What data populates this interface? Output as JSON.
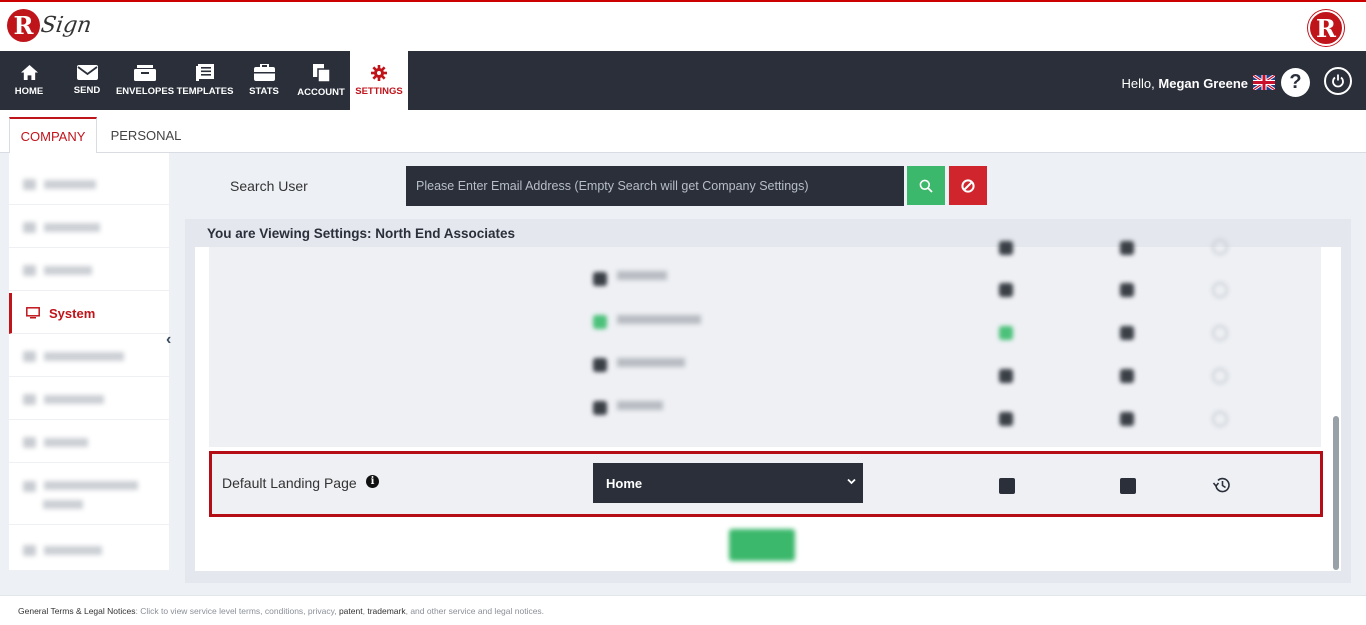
{
  "header": {
    "logo_letter": "R",
    "logo_text": "Sign",
    "right_logo_letter": "R"
  },
  "nav": {
    "items": [
      {
        "label": "HOME",
        "icon": "home-icon"
      },
      {
        "label": "SEND",
        "icon": "envelope-icon"
      },
      {
        "label": "ENVELOPES",
        "icon": "inbox-icon"
      },
      {
        "label": "TEMPLATES",
        "icon": "templates-icon"
      },
      {
        "label": "STATS",
        "icon": "briefcase-icon"
      },
      {
        "label": "ACCOUNT",
        "icon": "copy-icon"
      },
      {
        "label": "SETTINGS",
        "icon": "gear-icon",
        "active": true
      }
    ],
    "hello": "Hello,",
    "user_name": "Megan Greene",
    "help": "?"
  },
  "tabs": [
    {
      "label": "COMPANY",
      "active": true
    },
    {
      "label": "PERSONAL",
      "active": false
    }
  ],
  "sidebar": {
    "active_item": "System"
  },
  "search": {
    "label": "Search User",
    "placeholder": "Please Enter Email Address (Empty Search will get Company Settings)"
  },
  "panel": {
    "title": "You are Viewing Settings: North End Associates"
  },
  "landing": {
    "label": "Default Landing Page",
    "selected": "Home"
  },
  "footer": {
    "label": "General Terms & Legal Notices",
    "text_1": ": Click to view service level terms, conditions, privacy,",
    "patent": "patent",
    "comma": ",",
    "trademark": "trademark",
    "text_2": ", and other service and legal notices."
  },
  "colors": {
    "brand_red": "#c0141b",
    "nav_dark": "#2a2f3a",
    "success_green": "#3bb86b",
    "danger_red": "#d0252d"
  }
}
